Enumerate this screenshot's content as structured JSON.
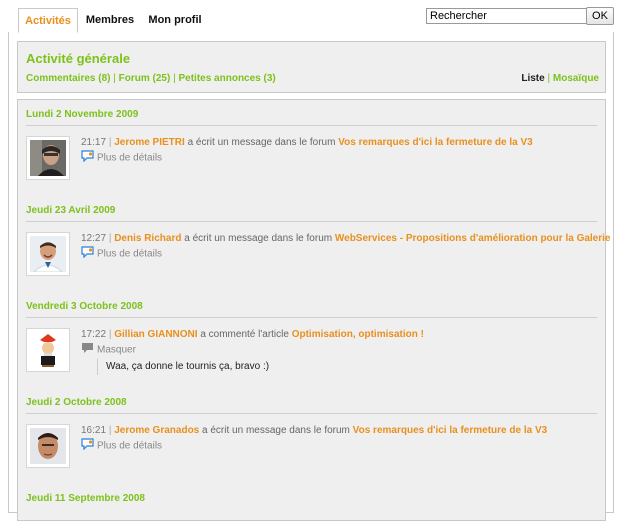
{
  "tabs": [
    {
      "label": "Activités"
    },
    {
      "label": "Membres"
    },
    {
      "label": "Mon profil"
    }
  ],
  "search": {
    "value": "Rechercher",
    "button_label": "OK"
  },
  "header": {
    "title": "Activité générale",
    "filters": [
      {
        "label": "Commentaires (8)"
      },
      {
        "label": "Forum (25)"
      },
      {
        "label": "Petites annonces (3)"
      }
    ],
    "filter_separator": "|",
    "views": {
      "list": "Liste",
      "separator": "|",
      "mosaic": "Mosaïque"
    }
  },
  "feed": [
    {
      "date": "Lundi 2 Novembre 2009",
      "time": "21:17",
      "sep": "|",
      "user": "Jerome PIETRI",
      "action": "a écrit un message dans le forum",
      "target": "Vos remarques d'ici la fermeture de la V3",
      "detail": "Plus de détails"
    },
    {
      "date": "Jeudi 23 Avril 2009",
      "time": "12:27",
      "sep": "|",
      "user": "Denis Richard",
      "action": "a écrit un message dans le forum",
      "target": "WebServices - Propositions d'amélioration pour la Galerie",
      "detail": "Plus de détails"
    },
    {
      "date": "Vendredi 3 Octobre 2008",
      "time": "17:22",
      "sep": "|",
      "user": "Gillian GIANNONI",
      "action": "a commenté l'article",
      "target": "Optimisation, optimisation !",
      "detail": "Masquer",
      "comment": "Waa, ça donne le tournis ça, bravo :)"
    },
    {
      "date": "Jeudi 2 Octobre 2008",
      "time": "16:21",
      "sep": "|",
      "user": "Jerome Granados",
      "action": "a écrit un message dans le forum",
      "target": "Vos remarques d'ici la fermeture de la V3",
      "detail": "Plus de détails"
    },
    {
      "date": "Jeudi 11 Septembre 2008"
    }
  ],
  "colors": {
    "accent_orange": "#e8901e",
    "accent_green": "#7cc21b",
    "panel_bg": "#efefef"
  },
  "icons": {
    "details": "speech-bubble-icon",
    "hide": "gray-bubble-icon"
  }
}
